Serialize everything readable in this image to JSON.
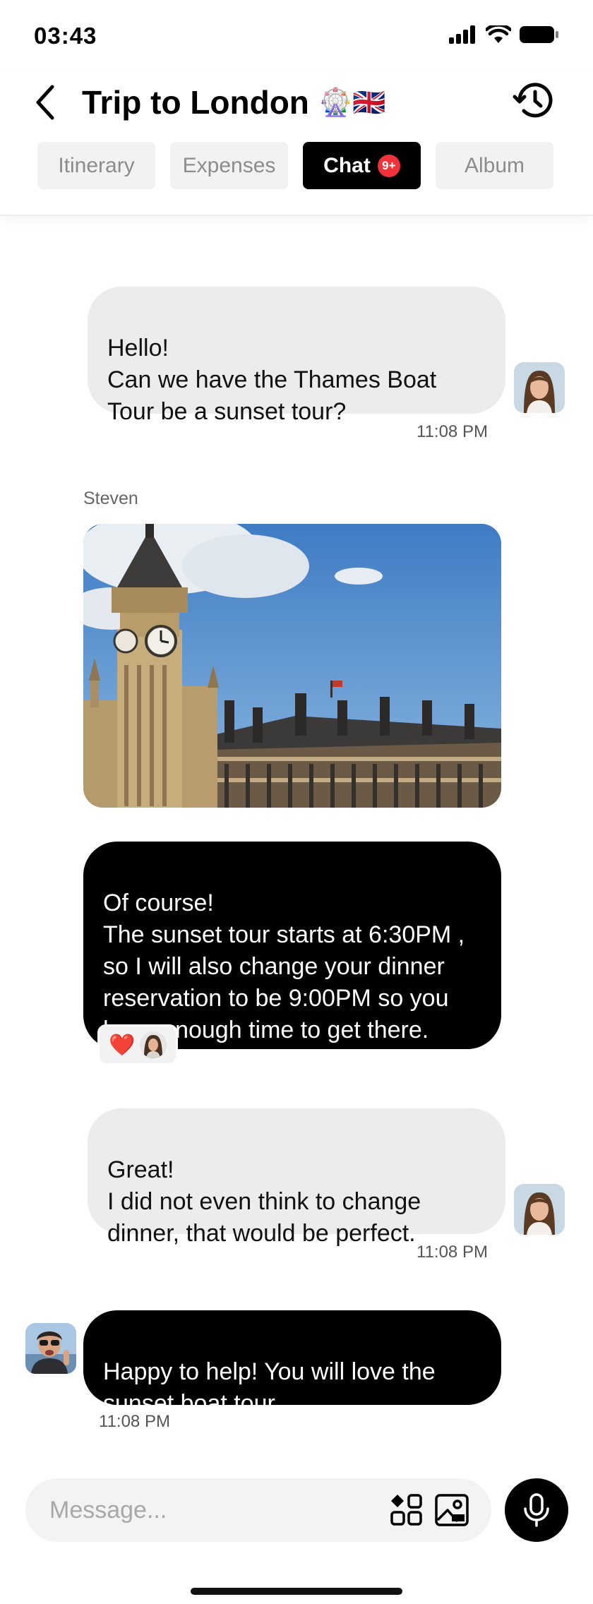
{
  "status_bar": {
    "time": "03:43"
  },
  "header": {
    "title": "Trip to London",
    "title_emoji": "🎡🇬🇧"
  },
  "tabs": [
    {
      "label": "Itinerary",
      "active": false
    },
    {
      "label": "Expenses",
      "active": false
    },
    {
      "label": "Chat",
      "active": true,
      "badge": "9+"
    },
    {
      "label": "Album",
      "active": false
    }
  ],
  "messages": [
    {
      "from": "me",
      "text": "Hello!\nCan we have the Thames Boat Tour be a sunset tour?",
      "time": "11:08 PM"
    },
    {
      "from": "Steven",
      "sender_name": "Steven",
      "type": "image"
    },
    {
      "from": "Steven",
      "text": "Of course!\nThe sunset tour starts at 6:30PM , so I will also change your dinner reservation to be 9:00PM so you have enough time to get there.",
      "reaction": "❤️"
    },
    {
      "from": "me",
      "text": "Great!\nI did not even think to change dinner, that would be perfect.",
      "time": "11:08 PM"
    },
    {
      "from": "Steven",
      "text": "Happy to help!  You will love the sunset boat tour.",
      "time": "11:08 PM"
    }
  ],
  "composer": {
    "placeholder": "Message..."
  },
  "colors": {
    "accent": "#000000",
    "badge": "#f0333a",
    "bubble_mine": "#ececec"
  }
}
